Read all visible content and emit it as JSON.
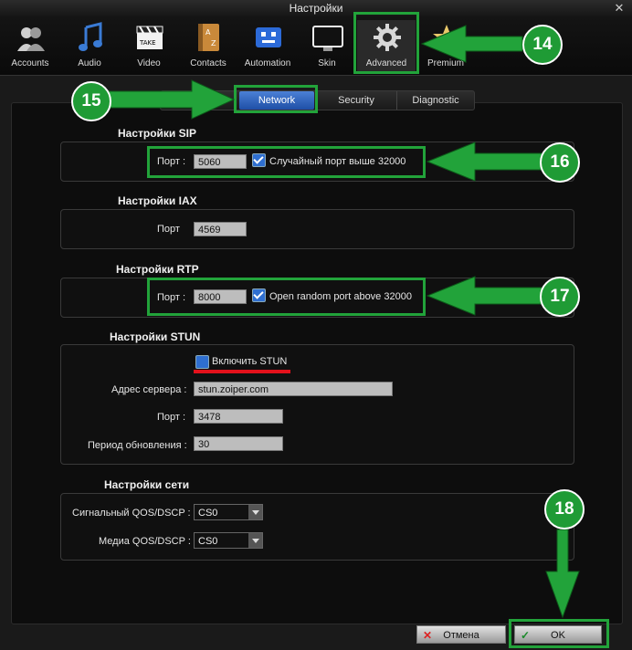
{
  "window": {
    "title": "Настройки",
    "close_glyph": "✕"
  },
  "toolbar": {
    "items": [
      {
        "label": "Accounts",
        "icon": "accounts-icon"
      },
      {
        "label": "Audio",
        "icon": "audio-icon"
      },
      {
        "label": "Video",
        "icon": "video-icon"
      },
      {
        "label": "Contacts",
        "icon": "contacts-icon"
      },
      {
        "label": "Automation",
        "icon": "automation-icon"
      },
      {
        "label": "Skin",
        "icon": "skin-icon"
      },
      {
        "label": "Advanced",
        "icon": "gear-icon",
        "active": true
      },
      {
        "label": "Premium",
        "icon": "star-icon"
      }
    ]
  },
  "tabs": {
    "network": "Network",
    "security": "Security",
    "diagnostic": "Diagnostic",
    "active": "Network"
  },
  "sip": {
    "title": "Настройки SIP",
    "port_label": "Порт :",
    "port_value": "5060",
    "random_label": "Случайный порт выше 32000",
    "random_checked": true
  },
  "iax": {
    "title": "Настройки IAX",
    "port_label": "Порт",
    "port_value": "4569"
  },
  "rtp": {
    "title": "Настройки RTP",
    "port_label": "Порт :",
    "port_value": "8000",
    "random_label": "Open random port above 32000",
    "random_checked": true
  },
  "stun": {
    "title": "Настройки STUN",
    "enable_label": "Включить STUN",
    "enabled": false,
    "server_label": "Адрес сервера :",
    "server_value": "stun.zoiper.com",
    "port_label": "Порт :",
    "port_value": "3478",
    "refresh_label": "Период обновления :",
    "refresh_value": "30"
  },
  "network": {
    "title": "Настройки сети",
    "signal_qos_label": "Сигнальный QOS/DSCP :",
    "signal_qos_value": "CS0",
    "media_qos_label": "Медиа QOS/DSCP :",
    "media_qos_value": "CS0"
  },
  "footer": {
    "cancel_label": "Отмена",
    "ok_label": "OK"
  },
  "annotations": {
    "b14": "14",
    "b15": "15",
    "b16": "16",
    "b17": "17",
    "b18": "18"
  },
  "colors": {
    "accent_green": "#22a33a",
    "highlight_red": "#e3111b",
    "active_tab_blue": "#2f64c0"
  }
}
